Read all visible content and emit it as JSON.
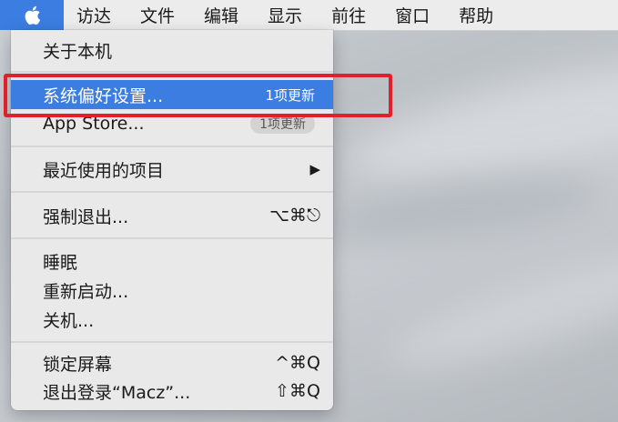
{
  "menubar": {
    "apple_icon": "apple-logo-icon",
    "items": [
      "访达",
      "文件",
      "编辑",
      "显示",
      "前往",
      "窗口",
      "帮助"
    ]
  },
  "apple_menu": {
    "about": "关于本机",
    "system_prefs": {
      "label": "系统偏好设置...",
      "badge": "1项更新"
    },
    "app_store": {
      "label": "App Store...",
      "badge": "1项更新"
    },
    "recent_items": {
      "label": "最近使用的项目",
      "arrow": "▶"
    },
    "force_quit": {
      "label": "强制退出...",
      "shortcut": "⌥⌘⎋"
    },
    "sleep": "睡眠",
    "restart": "重新启动...",
    "shutdown": "关机...",
    "lock_screen": {
      "label": "锁定屏幕",
      "shortcut": "^⌘Q"
    },
    "logout": {
      "label": "退出登录“Macz”...",
      "shortcut": "⇧⌘Q"
    }
  },
  "colors": {
    "highlight": "#3b7de1",
    "annotation": "#e0212b"
  }
}
